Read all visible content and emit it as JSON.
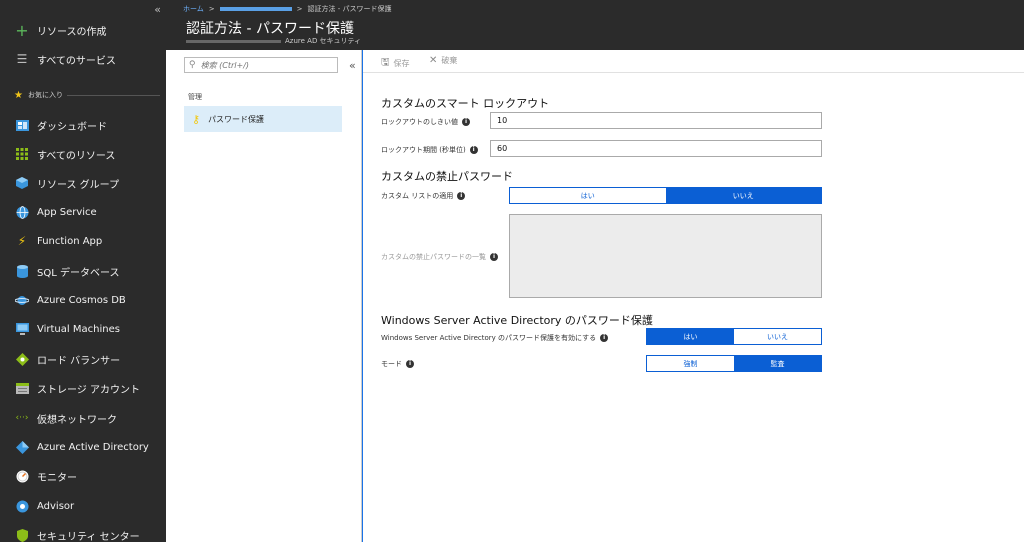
{
  "nav": {
    "collapse": "«",
    "create": "リソースの作成",
    "all_services": "すべてのサービス",
    "favorites": "お気に入り",
    "items": [
      {
        "label": "ダッシュボード",
        "icon": "dashboard-icon"
      },
      {
        "label": "すべてのリソース",
        "icon": "grid-icon"
      },
      {
        "label": "リソース グループ",
        "icon": "cube-icon"
      },
      {
        "label": "App Service",
        "icon": "globe-icon"
      },
      {
        "label": "Function App",
        "icon": "lightning-icon"
      },
      {
        "label": "SQL データベース",
        "icon": "database-icon"
      },
      {
        "label": "Azure Cosmos DB",
        "icon": "planet-icon"
      },
      {
        "label": "Virtual Machines",
        "icon": "monitor-icon"
      },
      {
        "label": "ロード バランサー",
        "icon": "diamond-icon"
      },
      {
        "label": "ストレージ アカウント",
        "icon": "storage-icon"
      },
      {
        "label": "仮想ネットワーク",
        "icon": "network-icon"
      },
      {
        "label": "Azure Active Directory",
        "icon": "aad-icon"
      },
      {
        "label": "モニター",
        "icon": "gauge-icon"
      },
      {
        "label": "Advisor",
        "icon": "advisor-icon"
      },
      {
        "label": "セキュリティ センター",
        "icon": "shield-icon"
      }
    ]
  },
  "header": {
    "breadcrumb_home": "ホーム",
    "breadcrumb_sep": ">",
    "breadcrumb_current": "認証方法 - パスワード保護",
    "title": "認証方法 - パスワード保護",
    "subtitle": "Azure AD セキュリティ"
  },
  "blade": {
    "search_placeholder": "検索 (Ctrl+/)",
    "collapse": "«",
    "section": "管理",
    "menu_item": "パスワード保護"
  },
  "toolbar": {
    "save": "保存",
    "discard": "破棄"
  },
  "form": {
    "lockout_heading": "カスタムのスマート ロックアウト",
    "lockout_threshold_label": "ロックアウトのしきい値",
    "lockout_threshold_value": "10",
    "lockout_duration_label": "ロックアウト期間 (秒単位)",
    "lockout_duration_value": "60",
    "banned_heading": "カスタムの禁止パスワード",
    "enforce_label": "カスタム リストの適用",
    "yes": "はい",
    "no": "いいえ",
    "banned_list_label": "カスタムの禁止パスワードの一覧",
    "wsad_heading": "Windows Server Active Directory のパスワード保護",
    "wsad_enable_label": "Windows Server Active Directory のパスワード保護を有効にする",
    "mode_label": "モード",
    "enforced": "強制",
    "audit": "監査"
  },
  "colors": {
    "accent": "#0b5fd4",
    "nav_bg": "#2b2b2b",
    "selected_menu": "#dcedf9"
  }
}
